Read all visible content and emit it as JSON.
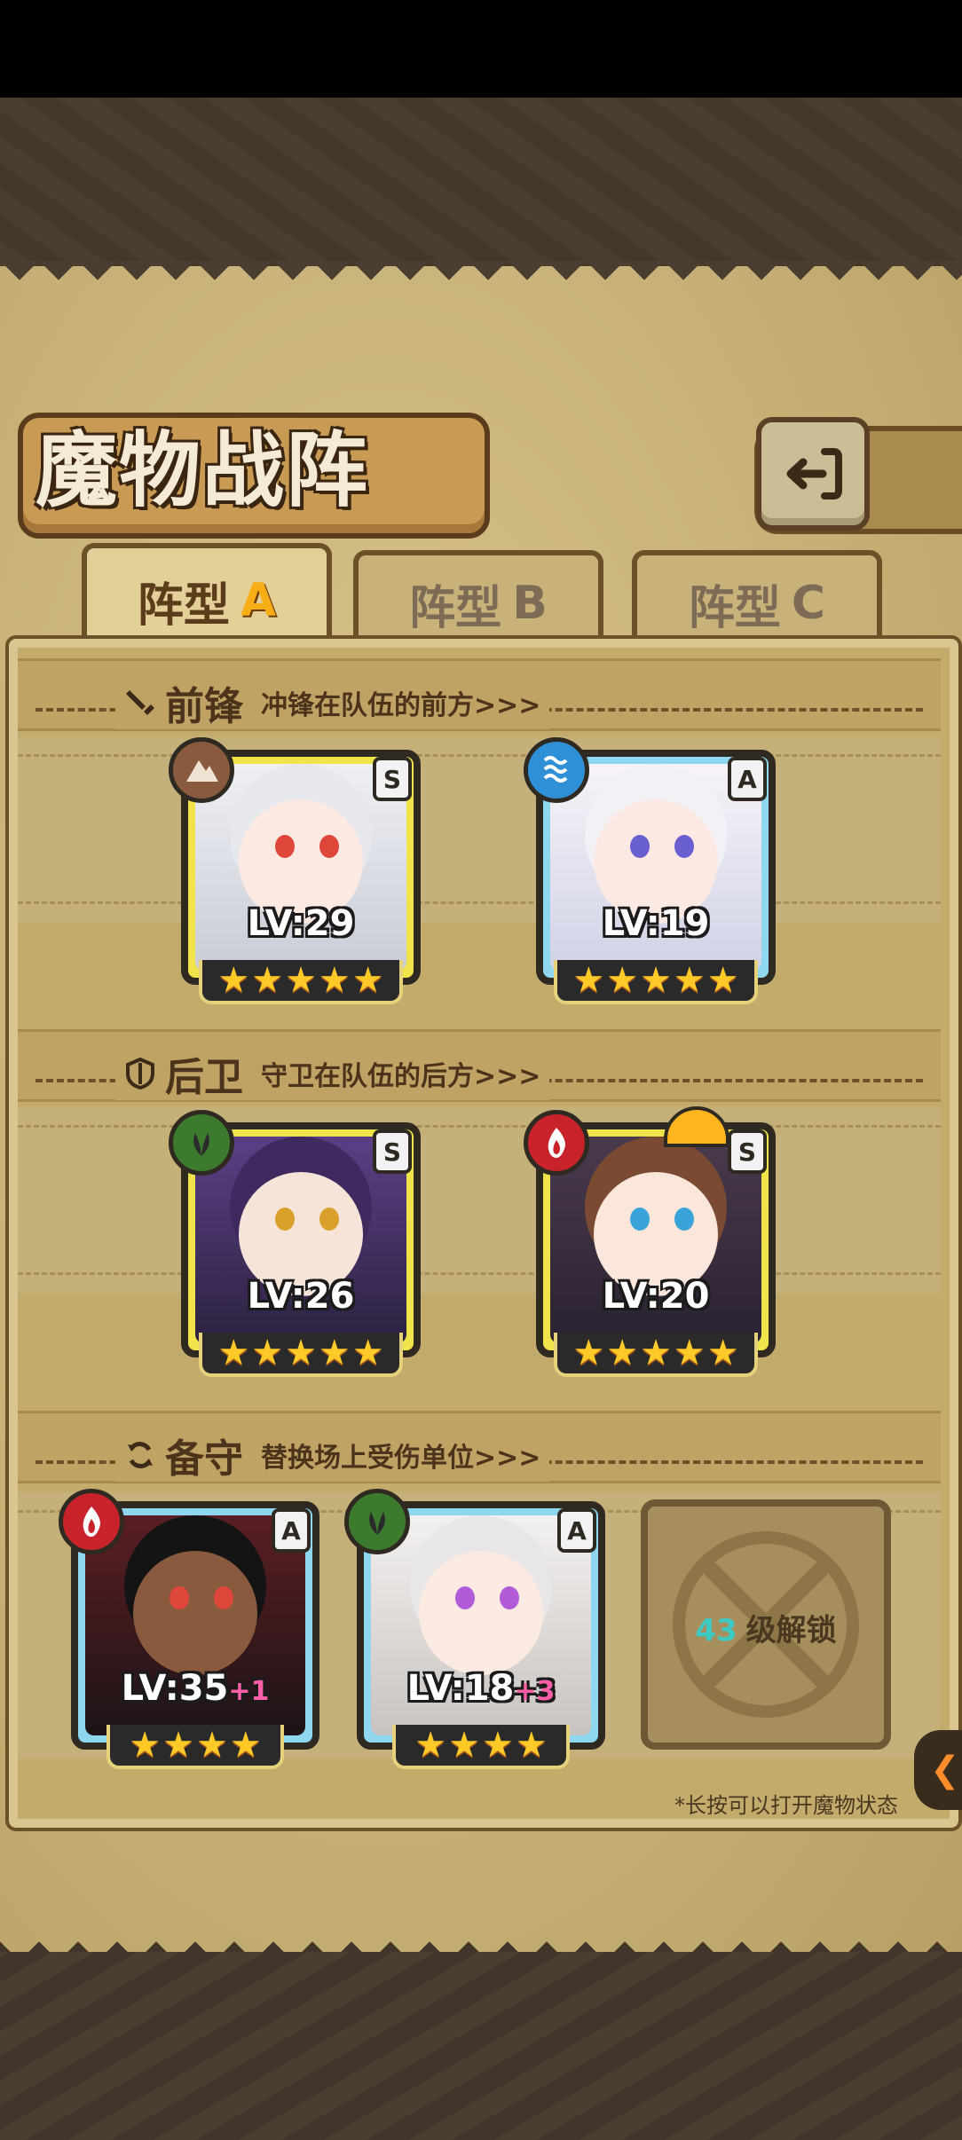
{
  "screen": {
    "title": "魔物战阵",
    "back_label": "back"
  },
  "tabs": [
    {
      "prefix": "阵型",
      "letter": "A",
      "active": true
    },
    {
      "prefix": "阵型",
      "letter": "B",
      "active": false
    },
    {
      "prefix": "阵型",
      "letter": "C",
      "active": false
    }
  ],
  "sections": {
    "front": {
      "title": "前锋",
      "desc": "冲锋在队伍的前方>>>",
      "icon": "sword-icon"
    },
    "back": {
      "title": "后卫",
      "desc": "守卫在队伍的后方>>>",
      "icon": "shield-icon"
    },
    "reserve": {
      "title": "备守",
      "desc": "替换场上受伤单位>>>",
      "icon": "swap-icon"
    }
  },
  "units": {
    "front1": {
      "level": "LV:29",
      "rank": "S",
      "element": "earth-icon",
      "stars": 5
    },
    "front2": {
      "level": "LV:19",
      "rank": "A",
      "element": "water-icon",
      "stars": 5
    },
    "back1": {
      "level": "LV:26",
      "rank": "S",
      "element": "wood-icon",
      "stars": 5
    },
    "back2": {
      "level": "LV:20",
      "rank": "S",
      "element": "fire-icon",
      "stars": 5
    },
    "reserve1": {
      "level": "LV:35",
      "bonus": "+1",
      "rank": "A",
      "element": "fire-icon",
      "stars": 4
    },
    "reserve2": {
      "level": "LV:18",
      "bonus": "+3",
      "rank": "A",
      "element": "wood-icon",
      "stars": 4
    }
  },
  "locked_slot": {
    "level_required": "43",
    "label": "级解锁"
  },
  "hint": "*长按可以打开魔物状态",
  "colors": {
    "parchment": "#c8b277",
    "frame_s": "#f0e44a",
    "frame_a": "#8fd6ef",
    "star": "#ffc928",
    "accent_tab": "#f6ad16"
  }
}
